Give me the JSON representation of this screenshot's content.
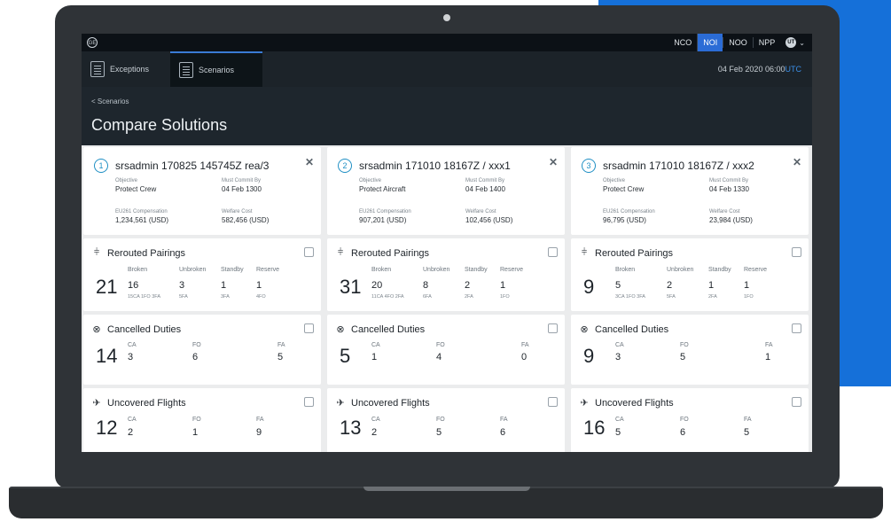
{
  "topbar": {
    "logo": "GE",
    "nav": [
      "NCO",
      "NOI",
      "NOO",
      "NPP"
    ],
    "active_nav": "NOI",
    "user_initials": "UT"
  },
  "tabs": [
    {
      "label": "Exceptions",
      "icon": "list-icon"
    },
    {
      "label": "Scenarios",
      "icon": "scenarios-icon"
    }
  ],
  "datetime": {
    "date": "04 Feb 2020",
    "time": "06:00",
    "tz": "UTC"
  },
  "breadcrumb": "< Scenarios",
  "page_title": "Compare Solutions",
  "labels": {
    "objective": "Objective",
    "must_commit": "Must Commit By",
    "eu261": "EU261 Compensation",
    "welfare": "Welfare Cost",
    "rerouted": "Rerouted Pairings",
    "cancelled": "Cancelled Duties",
    "uncovered": "Uncovered Flights",
    "broken": "Broken",
    "unbroken": "Unbroken",
    "standby": "Standby",
    "reserve": "Reserve",
    "ca": "CA",
    "fo": "FO",
    "fa": "FA",
    "close": "✕"
  },
  "solutions": [
    {
      "number": "1",
      "name": "srsadmin 170825 145745Z rea/3",
      "objective": "Protect Crew",
      "must_commit": "04 Feb 1300",
      "eu261": "1,234,561 (USD)",
      "welfare": "582,456 (USD)",
      "rerouted": {
        "total": "21",
        "broken": "16",
        "broken_sub": "15CA 1FO 3FA",
        "unbroken": "3",
        "unbroken_sub": "5FA",
        "standby": "1",
        "standby_sub": "3FA",
        "reserve": "1",
        "reserve_sub": "4FO"
      },
      "cancelled": {
        "total": "14",
        "ca": "3",
        "fo": "6",
        "fa": "5"
      },
      "uncovered": {
        "total": "12",
        "ca": "2",
        "fo": "1",
        "fa": "9"
      }
    },
    {
      "number": "2",
      "name": "srsadmin 171010 18167Z / xxx1",
      "objective": "Protect Aircraft",
      "must_commit": "04 Feb 1400",
      "eu261": "907,201 (USD)",
      "welfare": "102,456 (USD)",
      "rerouted": {
        "total": "31",
        "broken": "20",
        "broken_sub": "11CA 4FO 2FA",
        "unbroken": "8",
        "unbroken_sub": "6FA",
        "standby": "2",
        "standby_sub": "2FA",
        "reserve": "1",
        "reserve_sub": "1FO"
      },
      "cancelled": {
        "total": "5",
        "ca": "1",
        "fo": "4",
        "fa": "0"
      },
      "uncovered": {
        "total": "13",
        "ca": "2",
        "fo": "5",
        "fa": "6"
      }
    },
    {
      "number": "3",
      "name": "srsadmin 171010 18167Z / xxx2",
      "objective": "Protect Crew",
      "must_commit": "04 Feb 1330",
      "eu261": "96,795 (USD)",
      "welfare": "23,984 (USD)",
      "rerouted": {
        "total": "9",
        "broken": "5",
        "broken_sub": "3CA 1FO 3FA",
        "unbroken": "2",
        "unbroken_sub": "5FA",
        "standby": "1",
        "standby_sub": "2FA",
        "reserve": "1",
        "reserve_sub": "1FO"
      },
      "cancelled": {
        "total": "9",
        "ca": "3",
        "fo": "5",
        "fa": "1"
      },
      "uncovered": {
        "total": "16",
        "ca": "5",
        "fo": "6",
        "fa": "5"
      }
    }
  ]
}
